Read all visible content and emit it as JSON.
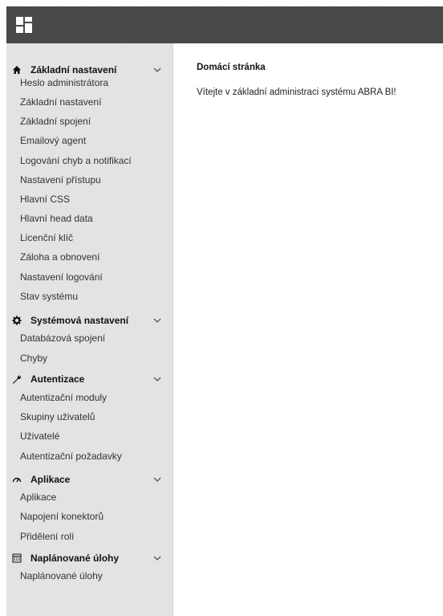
{
  "main": {
    "title": "Domácí stránka",
    "welcome": "Vítejte v základní administraci systému ABRA BI!"
  },
  "sidebar": {
    "sections": [
      {
        "icon": "home-icon",
        "label": "Základní nastavení",
        "items": [
          "Heslo administrátora",
          "Základní nastavení",
          "Základní spojení",
          "Emailový agent",
          "Logování chyb a notifikací",
          "Nastavení přístupu",
          "Hlavní CSS",
          "Hlavní head data",
          "Licenční klíč",
          "Záloha a obnovení",
          "Nastavení logování",
          "Stav systému"
        ]
      },
      {
        "icon": "gear-icon",
        "label": "Systémová nastavení",
        "items": [
          "Databázová spojení",
          "Chyby"
        ]
      },
      {
        "icon": "wrench-icon",
        "label": "Autentizace",
        "items": [
          "Autentizační moduly",
          "Skupiny uživatelů",
          "Uživatelé",
          "Autentizační požadavky"
        ]
      },
      {
        "icon": "dashboard-icon",
        "label": "Aplikace",
        "items": [
          "Aplikace",
          "Napojení konektorů",
          "Přidělení rolí"
        ]
      },
      {
        "icon": "calendar-icon",
        "label": "Naplánované úlohy",
        "items": [
          "Naplánované úlohy"
        ]
      }
    ]
  }
}
